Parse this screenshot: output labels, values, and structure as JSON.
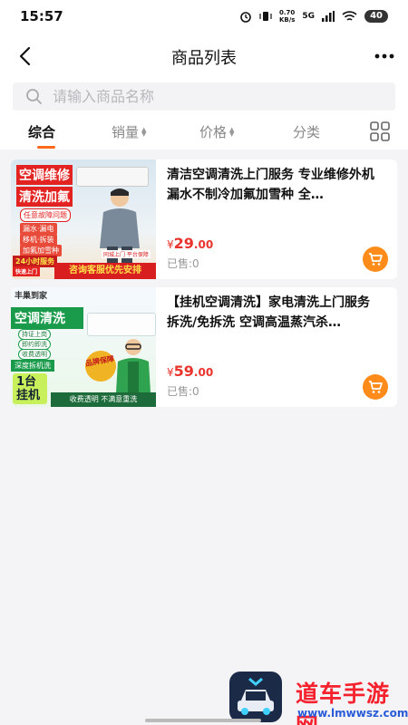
{
  "status_bar": {
    "time": "15:57",
    "net_speed_value": "0.70",
    "net_speed_unit": "KB/s",
    "signal": "5G",
    "battery": "40"
  },
  "nav": {
    "title": "商品列表",
    "back_icon": "chevron-left-icon",
    "more_icon": "more-dots-icon"
  },
  "search": {
    "placeholder": "请输入商品名称",
    "value": ""
  },
  "tabs": [
    {
      "label": "综合",
      "active": true
    },
    {
      "label": "销量",
      "sortable": true
    },
    {
      "label": "价格",
      "sortable": true
    },
    {
      "label": "分类"
    }
  ],
  "colors": {
    "accent": "#ff6a1a",
    "price": "#e8342d",
    "cart": "#ff8c1a",
    "background": "#f4f4f6"
  },
  "products": [
    {
      "title": "清洁空调清洗上门服务 专业维修外机 漏水不制冷加氟加雪种 全…",
      "price_currency": "¥",
      "price_int": "29",
      "price_dec": ".00",
      "sold": "已售:0",
      "thumb": {
        "line1": "空调维修",
        "line2": "清洗加氟",
        "tag": "任意故障问题",
        "chips": [
          "漏水·漏电",
          "移机·拆装",
          "加氟加雪种"
        ],
        "badge": "24小时服务",
        "badge_sub": "快速上门",
        "mini": "同城上门  平台保障",
        "bottom": "咨询客服优先安排"
      }
    },
    {
      "title": "【挂机空调清洗】家电清洗上门服务 拆洗/免拆洗 空调高温蒸汽杀…",
      "price_currency": "¥",
      "price_int": "59",
      "price_dec": ".00",
      "sold": "已售:0",
      "thumb": {
        "brand": "丰巢到家",
        "line1": "空调清洗",
        "chips": [
          "持证上岗",
          "即约即洗",
          "收费透明"
        ],
        "deep": "深度拆机洗",
        "one": "1台",
        "one2": "挂机",
        "seal": "品牌保障",
        "bottom": "收费透明  不满意重洗"
      }
    }
  ],
  "watermark": {
    "text": "道车手游网",
    "url": "www.lmwwsz.com"
  }
}
